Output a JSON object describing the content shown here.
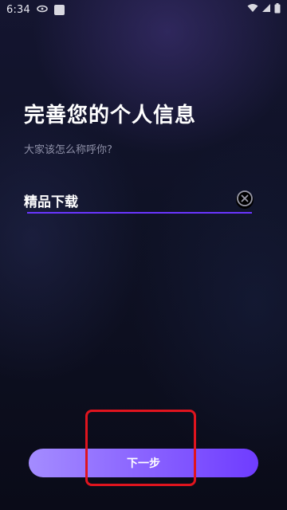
{
  "status_bar": {
    "time": "6:34",
    "icons": [
      "notification-icon",
      "app-icon",
      "wifi-icon",
      "signal-icon",
      "battery-icon"
    ]
  },
  "page": {
    "title": "完善您的个人信息",
    "subtitle": "大家该怎么称呼你?"
  },
  "name_field": {
    "value": "精品下载",
    "clear_icon": "clear-icon"
  },
  "actions": {
    "next_label": "下一步"
  },
  "colors": {
    "accent": "#6a35ff",
    "button_gradient_start": "#a48cff",
    "button_gradient_end": "#6f3cff",
    "highlight": "#e0141e"
  }
}
